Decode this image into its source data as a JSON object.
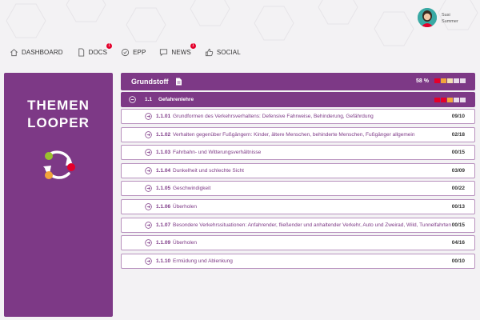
{
  "user": {
    "first_name": "Susi",
    "last_name": "Summer"
  },
  "nav": [
    {
      "label": "DASHBOARD",
      "icon": "home-icon",
      "badge": ""
    },
    {
      "label": "DOCS",
      "icon": "document-icon",
      "badge": "1"
    },
    {
      "label": "EPP",
      "icon": "check-circle-icon",
      "badge": ""
    },
    {
      "label": "NEWS",
      "icon": "chat-icon",
      "badge": "1"
    },
    {
      "label": "SOCIAL",
      "icon": "thumbs-up-icon",
      "badge": ""
    }
  ],
  "panel": {
    "title_line1": "THEMEN",
    "title_line2": "LOOPER"
  },
  "topic": {
    "title": "Grundstoff",
    "percent": "58 %",
    "progress_colors": [
      "#e4002b",
      "#f2a43a",
      "#f2e0b4",
      "#e8dbe9",
      "#e8dbe9"
    ]
  },
  "subtopic": {
    "number": "1.1",
    "title": "Gefahrenlehre",
    "progress_colors": [
      "#e4002b",
      "#e4002b",
      "#f2a43a",
      "#e8dbe9",
      "#e8dbe9"
    ]
  },
  "items": [
    {
      "number": "1.1.01",
      "title": "Grundformen des Verkehrsverhaltens: Defensive Fahrweise, Behinderung, Gefährdung",
      "count": "09/10"
    },
    {
      "number": "1.1.02",
      "title": "Verhalten gegenüber Fußgängern: Kinder, ältere Menschen, behinderte Menschen, Fußgänger allgemein",
      "count": "02/18"
    },
    {
      "number": "1.1.03",
      "title": "Fahrbahn- und Witterungsverhältnisse",
      "count": "00/15"
    },
    {
      "number": "1.1.04",
      "title": "Dunkelheit und schlechte Sicht",
      "count": "03/09"
    },
    {
      "number": "1.1.05",
      "title": "Geschwindigkeit",
      "count": "00/22"
    },
    {
      "number": "1.1.06",
      "title": "Überholen",
      "count": "00/13"
    },
    {
      "number": "1.1.07",
      "title": "Besondere Verkehrssituationen: Anfahrender, fließender und anhaltender Verkehr, Auto und Zweirad, Wild, Tunnelfahrten",
      "count": "00/15"
    },
    {
      "number": "1.1.09",
      "title": "Überholen",
      "count": "04/16"
    },
    {
      "number": "1.1.10",
      "title": "Ermüdung und Ablenkung",
      "count": "00/10"
    }
  ],
  "colors": {
    "brand": "#7d3986",
    "accent_red": "#e4002b",
    "accent_orange": "#f2a43a",
    "accent_green": "#9bbf2f"
  }
}
